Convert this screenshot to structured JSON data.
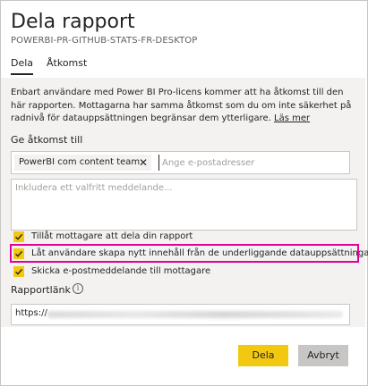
{
  "dialog": {
    "title": "Dela rapport",
    "subtitle": "POWERBI-PR-GITHUB-STATS-FR-DESKTOP"
  },
  "tabs": [
    {
      "label": "Dela",
      "active": true
    },
    {
      "label": "Åtkomst",
      "active": false
    }
  ],
  "description": {
    "text": "Enbart användare med Power BI Pro-licens kommer att ha åtkomst till den här rapporten. Mottagarna har samma åtkomst som du om inte säkerhet på radnivå för datauppsättningen begränsar dem ytterligare.",
    "link": "Läs mer"
  },
  "access": {
    "label": "Ge åtkomst till",
    "chip_label": "PowerBI com content team",
    "chip_close": "✕",
    "email_placeholder": "Ange e-postadresser",
    "message_placeholder": "Inkludera ett valfritt meddelande..."
  },
  "options": [
    {
      "label": "Tillåt mottagare att dela din rapport",
      "checked": true
    },
    {
      "label": "Låt användare skapa nytt innehåll från de underliggande datauppsättningarna",
      "checked": true,
      "highlighted": true
    },
    {
      "label": "Skicka e-postmeddelande till mottagare",
      "checked": true
    }
  ],
  "report_link": {
    "label": "Rapportlänk",
    "info_icon": "i",
    "prefix": "https://"
  },
  "buttons": {
    "primary": "Dela",
    "secondary": "Avbryt"
  },
  "colors": {
    "accent": "#f2c811",
    "highlight": "#e0009a",
    "panel": "#f3f2f1"
  }
}
